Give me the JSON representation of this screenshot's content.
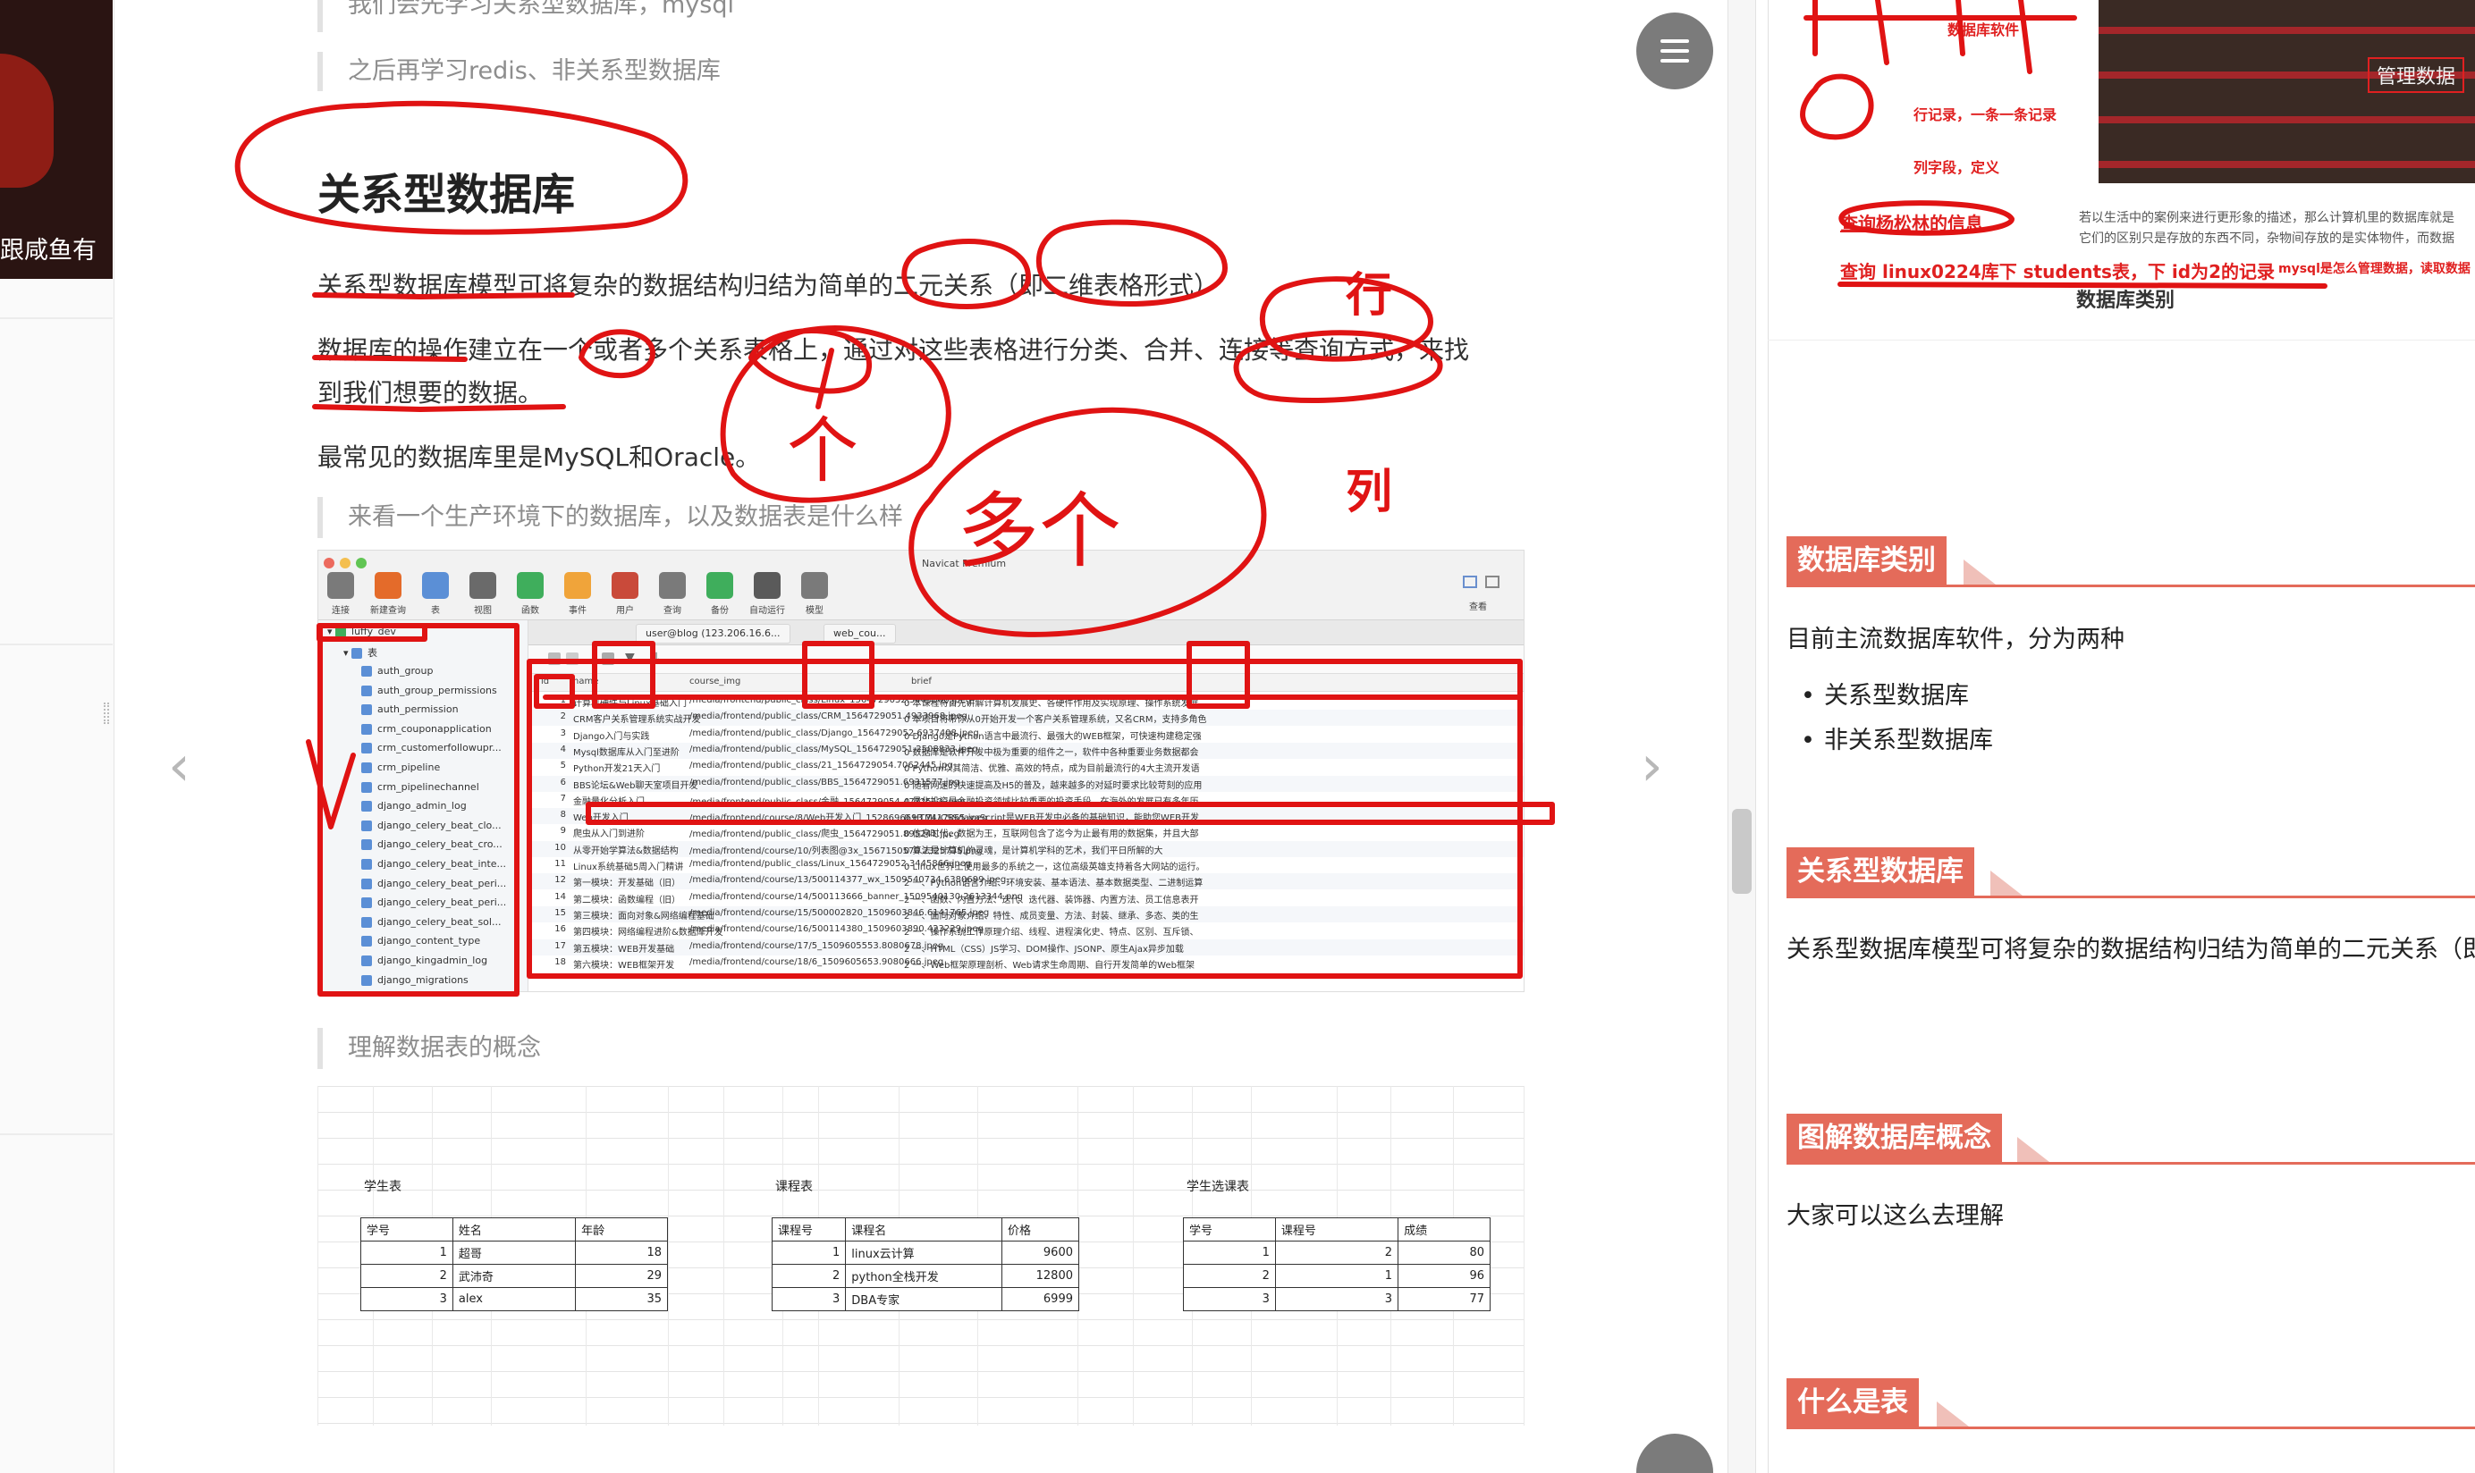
{
  "left_sidebar": {
    "video_caption": "跟咸鱼有"
  },
  "article": {
    "quote_top_1": "我们会先学习关系型数据库，mysql",
    "quote_top_2": "之后再学习redis、非关系型数据库",
    "heading": "关系型数据库",
    "para_1": "关系型数据库模型可将复杂的数据结构归结为简单的二元关系（即二维表格形式）",
    "para_2_line1": "数据库的操作建立在一个或者多个关系表格上，通过对这些表格进行分类、合并、连接等查询方式，来找",
    "para_2_line2": "到我们想要的数据。",
    "para_3": "最常见的数据库里是MySQL和Oracle。",
    "quote_mid": "来看一个生产环境下的数据库，以及数据表是什么样",
    "quote_bottom": "理解数据表的概念"
  },
  "navicat": {
    "window_title": "Navicat Premium",
    "toolbar": [
      "连接",
      "新建查询",
      "表",
      "视图",
      "函数",
      "事件",
      "用户",
      "查询",
      "备份",
      "自动运行",
      "模型"
    ],
    "right_toolbar_label": "查看",
    "db_name": "luffy_dev",
    "tables_folder": "表",
    "tree_items": [
      "auth_group",
      "auth_group_permissions",
      "auth_permission",
      "crm_couponapplication",
      "crm_customerfollowupr...",
      "crm_pipeline",
      "crm_pipelinechannel",
      "django_admin_log",
      "django_celery_beat_clo...",
      "django_celery_beat_cro...",
      "django_celery_beat_inte...",
      "django_celery_beat_peri...",
      "django_celery_beat_peri...",
      "django_celery_beat_sol...",
      "django_content_type",
      "django_kingadmin_log",
      "django_migrations"
    ],
    "tabs": [
      "user@blog (123.206.16.6...",
      "web_cou..."
    ],
    "columns": [
      "id",
      "name",
      "course_img",
      "brief"
    ],
    "rows": [
      {
        "id": "1",
        "name": "计算机硬件与Linux基础入门",
        "img": "/media/frontend/public_class/Linux_1564729052.3445866.jpeg",
        "brief": "0  本课程将首先讲解计算机发展史、各硬件作用及实现原理、操作系统发展"
      },
      {
        "id": "2",
        "name": "CRM客户关系管理系统实战开发",
        "img": "/media/frontend/public_class/CRM_1564729051.4933968.jpeg",
        "brief": "0  本项目将带你从0开始开发一个客户关系管理系统，又名CRM，支持多角色"
      },
      {
        "id": "3",
        "name": "Django入门与实践",
        "img": "/media/frontend/public_class/Django_1564729052.6937408.jpeg",
        "brief": "0  Django是Python语言中最流行、最强大的WEB框架，可快速构建稳定强"
      },
      {
        "id": "4",
        "name": "Mysql数据库从入门至进阶",
        "img": "/media/frontend/public_class/MySQL_1564729051.2508833.jpeg",
        "brief": "0  数据库是软件开发中极为重要的组件之一，软件中各种重要业务数据都会"
      },
      {
        "id": "5",
        "name": "Python开发21天入门",
        "img": "/media/frontend/public_class/21_1564729054.7062445.jpg",
        "brief": "0  Python以其简洁、优雅、高效的特点，成为目前最流行的4大主流开发语"
      },
      {
        "id": "6",
        "name": "BBS论坛&Web聊天室项目开发",
        "img": "/media/frontend/public_class/BBS_1564729051.6931577.jpg",
        "brief": "0  随着网速的快速提高及H5的普及，越来越多的对延时要求比较苛刻的应用"
      },
      {
        "id": "7",
        "name": "金融量化分析入门",
        "img": "/media/frontend/public_class/金融_1564729054.4772513.jpeg",
        "brief": "0  量化投资是金融投资领域比较重要的投资手段，在海外的发展已有多年历"
      },
      {
        "id": "8",
        "name": "Web开发入门",
        "img": "/media/frontend/course/8/Web开发入门_1528696693.7417865.jpeg",
        "brief": "0  HTML/CSS/JavaScript是WEB开发中必备的基础知识，能助您WEB开发"
      },
      {
        "id": "9",
        "name": "爬虫从入门到进阶",
        "img": "/media/frontend/public_class/爬虫_1564729051.895241.jpeg",
        "brief": "0  信息时代，数据为王，互联网包含了迄今为止最有用的数据集，并且大部"
      },
      {
        "id": "10",
        "name": "从零开始学算法&数据结构",
        "img": "/media/frontend/course/10/列表图@3x_1567150578.2325735.png",
        "brief": "0  算法是计算机的灵魂，是计算机学科的艺术，我们平日所解的大"
      },
      {
        "id": "11",
        "name": "Linux系统基础5周入门精讲",
        "img": "/media/frontend/public_class/Linux_1564729052.3445866.jpeg",
        "brief": "0  Linux世界上使用最多的系统之一，这位高级英雄支持着各大网站的运行。"
      },
      {
        "id": "12",
        "name": "第一模块：开发基础（旧）",
        "img": "/media/frontend/course/13/500114377_wx_1509540734.6380699.jpeg",
        "brief": "2  一、Python语言介绍、环境安装、基本语法、基本数据类型、二进制运算"
      },
      {
        "id": "14",
        "name": "第二模块：函数编程（旧）",
        "img": "/media/frontend/course/14/500113666_banner_1509540130.2613344.png",
        "brief": "2  一、函数、内置方法、迭代、迭代器、装饰器、内置方法、员工信息表开"
      },
      {
        "id": "15",
        "name": "第三模块：面向对象&网络编程基础",
        "img": "/media/frontend/course/15/500002820_1509603846.6141765.jpeg",
        "brief": "2  一、面向对象介绍、特性、成员变量、方法、封装、继承、多态、类的生"
      },
      {
        "id": "16",
        "name": "第四模块：网络编程进阶&数据库开发",
        "img": "/media/frontend/course/16/500114380_1509603890.423229.jpeg",
        "brief": "2  一、操作系统工作原理介绍、线程、进程演化史、特点、区别、互斥锁、"
      },
      {
        "id": "17",
        "name": "第五模块：WEB开发基础",
        "img": "/media/frontend/course/17/5_1509605553.8080678.jpeg",
        "brief": "2  一、HTML（CSS）JS学习、DOM操作、JSONP、原生Ajax异步加载"
      },
      {
        "id": "18",
        "name": "第六模块：WEB框架开发",
        "img": "/media/frontend/course/18/6_1509605653.9080666.jpeg",
        "brief": "2  一、Web框架原理剖析、Web请求生命周期、自行开发简单的Web框架"
      }
    ]
  },
  "sheet": {
    "students": {
      "title": "学生表",
      "headers": [
        "学号",
        "姓名",
        "年龄"
      ],
      "rows": [
        [
          "1",
          "超哥",
          "18"
        ],
        [
          "2",
          "武沛奇",
          "29"
        ],
        [
          "3",
          "alex",
          "35"
        ]
      ]
    },
    "courses": {
      "title": "课程表",
      "headers": [
        "课程号",
        "课程名",
        "价格"
      ],
      "rows": [
        [
          "1",
          "linux云计算",
          "9600"
        ],
        [
          "2",
          "python全栈开发",
          "12800"
        ],
        [
          "3",
          "DBA专家",
          "6999"
        ]
      ]
    },
    "selections": {
      "title": "学生选课表",
      "headers": [
        "学号",
        "课程号",
        "成绩"
      ],
      "rows": [
        [
          "1",
          "2",
          "80"
        ],
        [
          "2",
          "1",
          "96"
        ],
        [
          "3",
          "3",
          "77"
        ]
      ]
    }
  },
  "right_panel": {
    "mini_labels": {
      "software": "数据库软件",
      "row_note": "行记录，一条一条记录",
      "col_note": "列字段，定义",
      "query_1": "查询杨松林的信息",
      "query_2": "查询 linux0224库下 students表，下 id为2的记录",
      "query_2_tail": "mysql是怎么管理数据，读取数据",
      "category": "数据库类别",
      "desc_1": "若以生活中的案例来进行更形象的描述，那么计算机里的数据库就是",
      "desc_2": "它们的区别只是存放的东西不同，杂物间存放的是实体物件，而数据"
    },
    "store_label": "管理数据",
    "sections": [
      {
        "title": "数据库类别"
      },
      {
        "title": "关系型数据库"
      },
      {
        "title": "图解数据库概念"
      },
      {
        "title": "什么是表"
      }
    ],
    "categories_intro": "目前主流数据库软件，分为两种",
    "bullets": [
      "关系型数据库",
      "非关系型数据库"
    ],
    "relational_text": "关系型数据库模型可将复杂的数据结构归结为简单的二元关系（即二维表",
    "concept_text": "大家可以这么去理解"
  },
  "annotations": {
    "hang": "行",
    "lie": "列",
    "ge": "个",
    "duoge": "多个"
  },
  "colors": {
    "accent_red": "#e46b5a",
    "ink_red": "#e01313"
  }
}
